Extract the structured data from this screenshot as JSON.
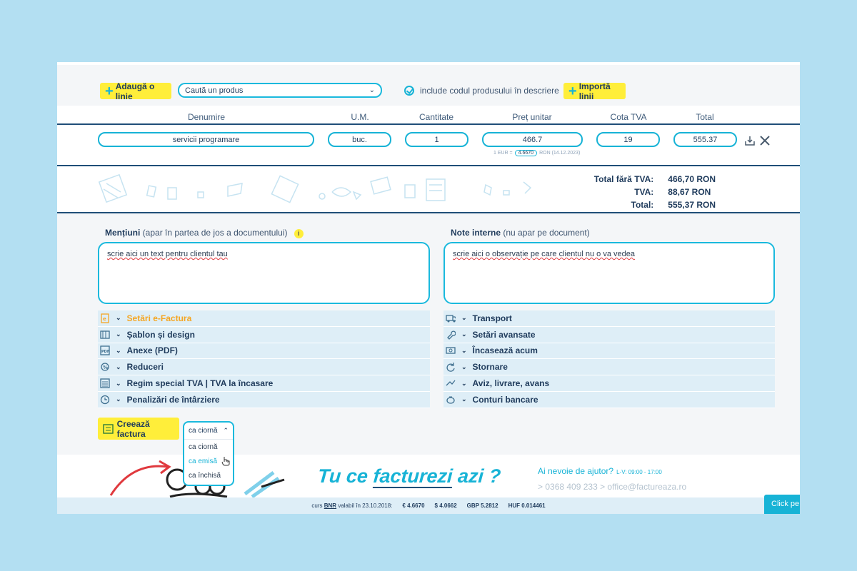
{
  "toolbar": {
    "add_line_label": "Adaugă o linie",
    "product_search_placeholder": "Caută un produs",
    "include_code_label": "include codul produsului în descriere",
    "import_lines_label": "Importă linii"
  },
  "table": {
    "headers": [
      "Denumire",
      "U.M.",
      "Cantitate",
      "Preț unitar",
      "Cota TVA",
      "Total"
    ],
    "row": {
      "name": "servicii programare",
      "unit": "buc.",
      "quantity": "1",
      "unit_price": "466.7",
      "vat_rate": "19",
      "total": "555.37"
    },
    "rate_note_prefix": "1 EUR =",
    "rate_value": "4.6670",
    "rate_note_suffix": "RON (14.12.2023)"
  },
  "totals": {
    "without_vat_label": "Total fără TVA:",
    "without_vat_value": "466,70 RON",
    "vat_label": "TVA:",
    "vat_value": "88,67 RON",
    "total_label": "Total:",
    "total_value": "555,37 RON"
  },
  "mentions": {
    "label": "Mențiuni",
    "sub": "(apar în partea de jos a documentului)",
    "text": "scrie aici un text pentru clientul tau"
  },
  "internal_notes": {
    "label": "Note interne",
    "sub": "(nu apar pe document)",
    "text": "scrie aici o observație pe care clientul nu o va vedea"
  },
  "left_sections": [
    {
      "label": "Setări e-Factura",
      "icon": "efactura-icon"
    },
    {
      "label": "Șablon și design",
      "icon": "template-icon"
    },
    {
      "label": "Anexe (PDF)",
      "icon": "pdf-icon"
    },
    {
      "label": "Reduceri",
      "icon": "discount-icon"
    },
    {
      "label": "Regim special TVA | TVA la încasare",
      "icon": "calculator-icon"
    },
    {
      "label": "Penalizări de întârziere",
      "icon": "clock-icon"
    }
  ],
  "right_sections": [
    {
      "label": "Transport",
      "icon": "truck-icon"
    },
    {
      "label": "Setări avansate",
      "icon": "wrench-icon"
    },
    {
      "label": "Încasează acum",
      "icon": "cash-icon"
    },
    {
      "label": "Stornare",
      "icon": "refresh-icon"
    },
    {
      "label": "Aviz, livrare, avans",
      "icon": "delivery-icon"
    },
    {
      "label": "Conturi bancare",
      "icon": "piggy-icon"
    }
  ],
  "create": {
    "button_label": "Creează factura",
    "selected": "ca ciornă",
    "options": [
      "ca ciornă",
      "ca emisă",
      "ca închisă"
    ]
  },
  "footer": {
    "slogan_a": "Tu ce ",
    "slogan_b": "facturezi",
    "slogan_c": " azi ?",
    "help_title": "Ai nevoie de ajutor?",
    "help_hours": "L-V: 09:00 - 17:00",
    "phone": "> 0368 409 233",
    "email": "> office@factureaza.ro",
    "rates_prefix": "curs",
    "rates_bnr": "BNR",
    "rates_date": "valabil în 23.10.2018:",
    "eur": "€ 4.6670",
    "usd": "$ 4.0662",
    "gbp": "GBP 5.2812",
    "huf": "HUF 0.014461",
    "chat": "Click pe"
  }
}
